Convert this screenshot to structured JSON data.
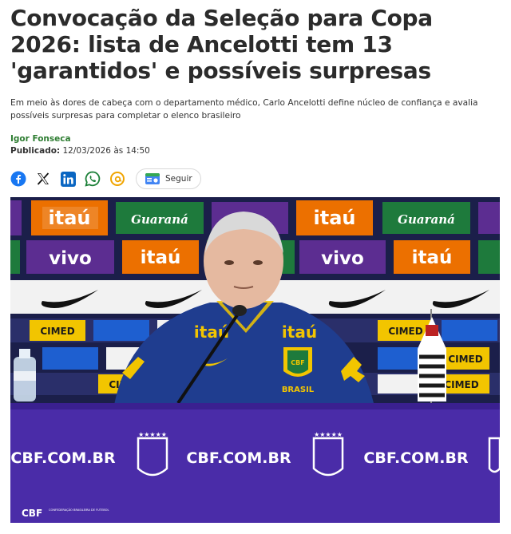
{
  "article": {
    "headline": "Convocação da Seleção para Copa 2026: lista de Ancelotti tem 13 'garantidos' e possíveis surpresas",
    "subtitle": "Em meio às dores de cabeça com o departamento médico, Carlo Ancelotti define núcleo de confiança e avalia possíveis surpresas para completar o elenco brasileiro",
    "author": "Igor Fonseca",
    "published_label": "Publicado:",
    "published_value": "12/03/2026 às 14:50"
  },
  "share": {
    "icons": [
      "facebook-icon",
      "x-icon",
      "linkedin-icon",
      "whatsapp-icon",
      "threads-icon"
    ],
    "follow_label": "Seguir"
  },
  "photo": {
    "banner_text_itau": "itaú",
    "banner_text_vivo": "vivo",
    "banner_text_guarana": "Guaraná",
    "banner_text_cimed": "CIMED",
    "shirt_sponsor": "itaú",
    "shirt_text": "BRASIL",
    "shield_text": "CBF",
    "table_text": "CBF.COM.BR",
    "footer_logo": "CBF",
    "footer_logo_sub": "CONFEDERAÇÃO BRASILEIRA DE FUTEBOL"
  },
  "colors": {
    "author": "#2e7d32",
    "backdrop_navy": "#1b1f4a",
    "table_purple": "#4a2ca8",
    "itau_orange": "#ec7000",
    "vivo_purple": "#5c2d91",
    "guarana_green": "#1e7a3c",
    "cimed_yellow": "#f2c500",
    "shirt_blue": "#1f3d8f"
  }
}
